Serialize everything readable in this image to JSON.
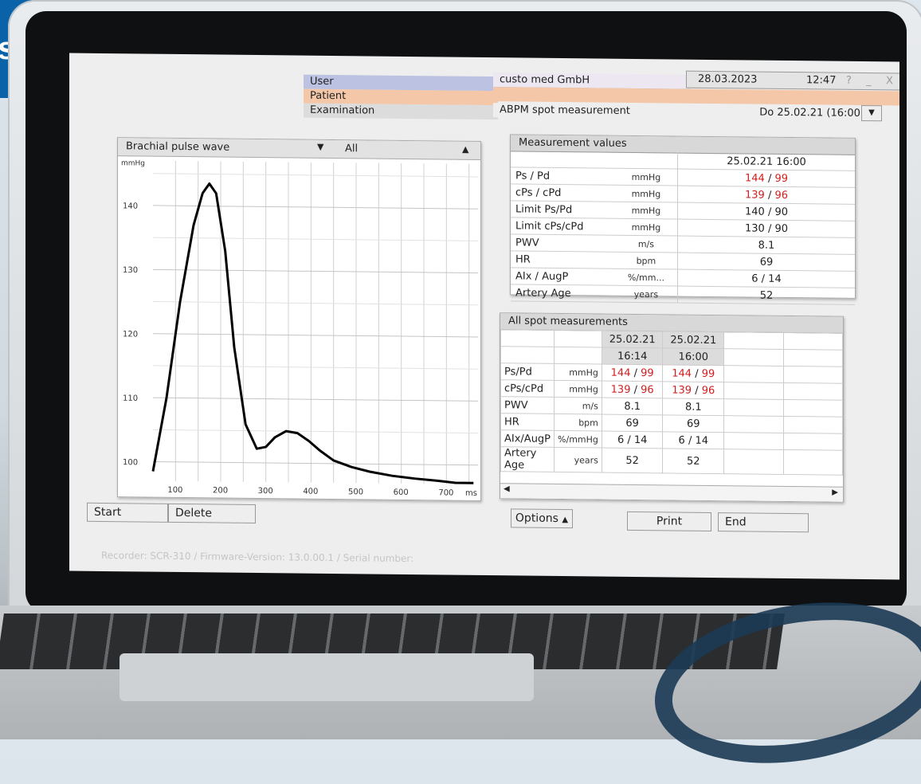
{
  "brand": {
    "text": "stic"
  },
  "header": {
    "user_label": "User",
    "patient_label": "Patient",
    "examination_label": "Examination",
    "company": "custo med GmbH",
    "date": "28.03.2023",
    "time": "12:47",
    "help": "?",
    "minimize": "_",
    "close": "X",
    "exam_type": "ABPM  spot measurement",
    "exam_date": "Do 25.02.21 (16:00)"
  },
  "wave_panel": {
    "select_label": "Brachial pulse wave",
    "filter_label": "All",
    "y_unit": "mmHg",
    "x_unit": "ms"
  },
  "chart_data": {
    "type": "line",
    "title": "Brachial pulse wave",
    "ylabel": "mmHg",
    "xlabel": "ms",
    "xlim": [
      50,
      770
    ],
    "ylim": [
      97,
      147
    ],
    "x_ticks": [
      100,
      200,
      300,
      400,
      500,
      600,
      700
    ],
    "y_ticks": [
      100,
      110,
      120,
      130,
      140
    ],
    "grid": true,
    "series": [
      {
        "x": [
          50,
          80,
          110,
          140,
          160,
          175,
          190,
          210,
          230,
          255,
          280,
          300,
          320,
          345,
          370,
          395,
          420,
          450,
          490,
          530,
          580,
          630,
          680,
          720,
          760
        ],
        "y": [
          98.5,
          110,
          125,
          137,
          142,
          143.5,
          142,
          133,
          118,
          106,
          102.2,
          102.5,
          104,
          105,
          104.7,
          103.5,
          102,
          100.5,
          99.5,
          98.8,
          98.2,
          97.8,
          97.5,
          97.2,
          97.2
        ]
      }
    ]
  },
  "measurement_values": {
    "title": "Measurement values",
    "date": "25.02.21 16:00",
    "rows": [
      {
        "label": "Ps / Pd",
        "unit": "mmHg",
        "v1": "144",
        "v2": "99",
        "red": true
      },
      {
        "label": "cPs / cPd",
        "unit": "mmHg",
        "v1": "139",
        "v2": "96",
        "red": true
      },
      {
        "label": "Limit Ps/Pd",
        "unit": "mmHg",
        "value": "140 / 90"
      },
      {
        "label": "Limit cPs/cPd",
        "unit": "mmHg",
        "value": "130 / 90"
      },
      {
        "label": "PWV",
        "unit": "m/s",
        "value": "8.1"
      },
      {
        "label": "HR",
        "unit": "bpm",
        "value": "69"
      },
      {
        "label": "AIx / AugP",
        "unit": "%/mm...",
        "value": "6 / 14"
      },
      {
        "label": "Artery Age",
        "unit": "years",
        "value": "52"
      }
    ]
  },
  "all_spot": {
    "title": "All spot measurements",
    "col1_date": "25.02.21",
    "col1_time": "16:14",
    "col2_date": "25.02.21",
    "col2_time": "16:00",
    "rows": [
      {
        "label": "Ps/Pd",
        "unit": "mmHg",
        "a1": "144",
        "a2": "99",
        "b1": "144",
        "b2": "99",
        "red": true
      },
      {
        "label": "cPs/cPd",
        "unit": "mmHg",
        "a1": "139",
        "a2": "96",
        "b1": "139",
        "b2": "96",
        "red": true
      },
      {
        "label": "PWV",
        "unit": "m/s",
        "a": "8.1",
        "b": "8.1"
      },
      {
        "label": "HR",
        "unit": "bpm",
        "a": "69",
        "b": "69"
      },
      {
        "label": "AIx/AugP",
        "unit": "%/mmHg",
        "a": "6 / 14",
        "b": "6 / 14"
      },
      {
        "label": "Artery Age",
        "unit": "years",
        "a": "52",
        "b": "52"
      }
    ]
  },
  "buttons": {
    "start": "Start",
    "delete": "Delete",
    "options": "Options",
    "print": "Print",
    "end": "End"
  },
  "status": "Recorder: SCR-310 / Firmware-Version: 13.0.00.1 / Serial number:"
}
